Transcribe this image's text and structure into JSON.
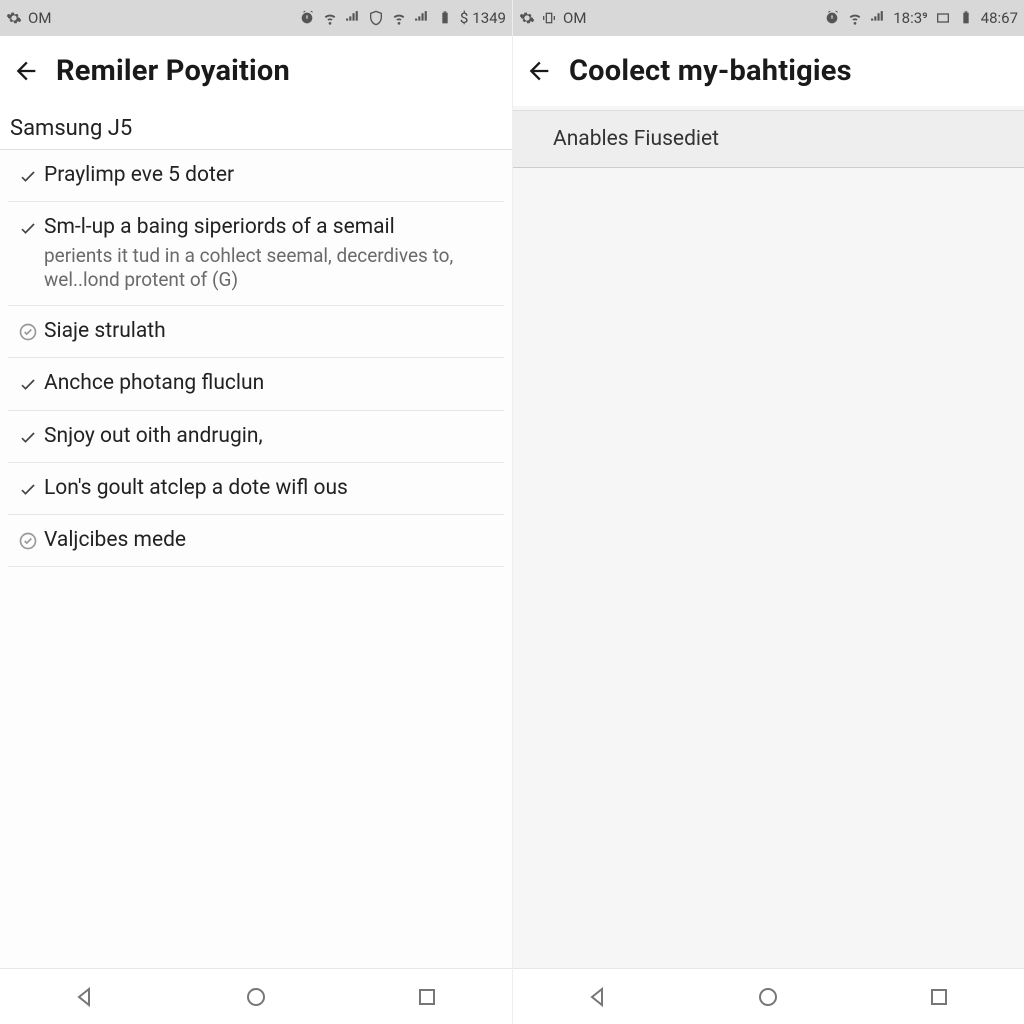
{
  "left": {
    "statusbar": {
      "om": "OM",
      "time": "1349",
      "dollar": "$"
    },
    "appbar": {
      "title": "Remiler Poyaition"
    },
    "subheader": "Samsung J5",
    "items": [
      {
        "icon": "check",
        "title": "Praylimp eve 5 doter",
        "sub": ""
      },
      {
        "icon": "check",
        "title": "Sm-l-up a baing siperiords of a semail",
        "sub": "perients it tud in a cohlect seemal, decerdives to, wel..lond protent of (G)"
      },
      {
        "icon": "circle-check",
        "title": "Siaje strulath",
        "sub": ""
      },
      {
        "icon": "check",
        "title": "Anchce photang fluclun",
        "sub": ""
      },
      {
        "icon": "check",
        "title": "Snjoy out oith andrugin,",
        "sub": ""
      },
      {
        "icon": "check",
        "title": "Lon's goult atclep a dote wifl ous",
        "sub": ""
      },
      {
        "icon": "circle-check",
        "title": "Valjcibes mede",
        "sub": ""
      }
    ]
  },
  "right": {
    "statusbar": {
      "om": "OM",
      "time1": "18:3⁹",
      "time2": "48:67"
    },
    "appbar": {
      "title": "Coolect my-bahtigies"
    },
    "row_label": "Anables Fiusediet"
  }
}
